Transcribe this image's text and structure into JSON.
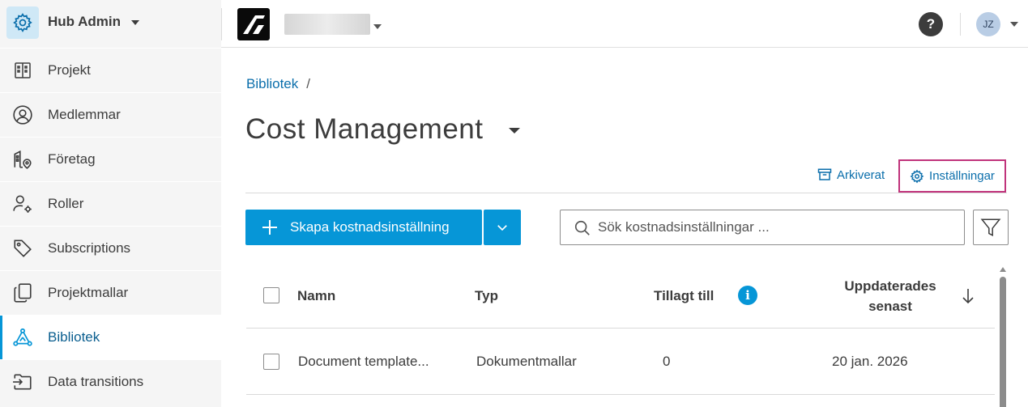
{
  "hub": {
    "title": "Hub Admin"
  },
  "sidebar": {
    "items": [
      {
        "label": "Projekt",
        "icon": "building-icon"
      },
      {
        "label": "Medlemmar",
        "icon": "user-circle-icon"
      },
      {
        "label": "Företag",
        "icon": "company-location-icon"
      },
      {
        "label": "Roller",
        "icon": "user-gear-icon"
      },
      {
        "label": "Subscriptions",
        "icon": "tag-icon"
      },
      {
        "label": "Projektmallar",
        "icon": "copy-icon"
      },
      {
        "label": "Bibliotek",
        "icon": "network-icon",
        "active": true
      },
      {
        "label": "Data transitions",
        "icon": "folder-transfer-icon"
      }
    ]
  },
  "topbar": {
    "help": "?",
    "avatar": "JZ"
  },
  "breadcrumb": {
    "root": "Bibliotek",
    "separator": "/"
  },
  "page": {
    "title": "Cost Management"
  },
  "actions": {
    "archived": "Arkiverat",
    "settings": "Inställningar"
  },
  "toolbar": {
    "create_label": "Skapa kostnadsinställning",
    "search_placeholder": "Sök kostnadsinställningar ..."
  },
  "table": {
    "columns": {
      "name": "Namn",
      "type": "Typ",
      "added_to": "Tillagt till",
      "updated_line1": "Uppdaterades",
      "updated_line2": "senast"
    },
    "rows": [
      {
        "name": "Document template...",
        "type": "Dokumentmallar",
        "added_to": "0",
        "updated": "20 jan. 2026"
      }
    ]
  },
  "colors": {
    "accent": "#0696d7",
    "link": "#0a6eab",
    "highlight": "#c0337b"
  }
}
